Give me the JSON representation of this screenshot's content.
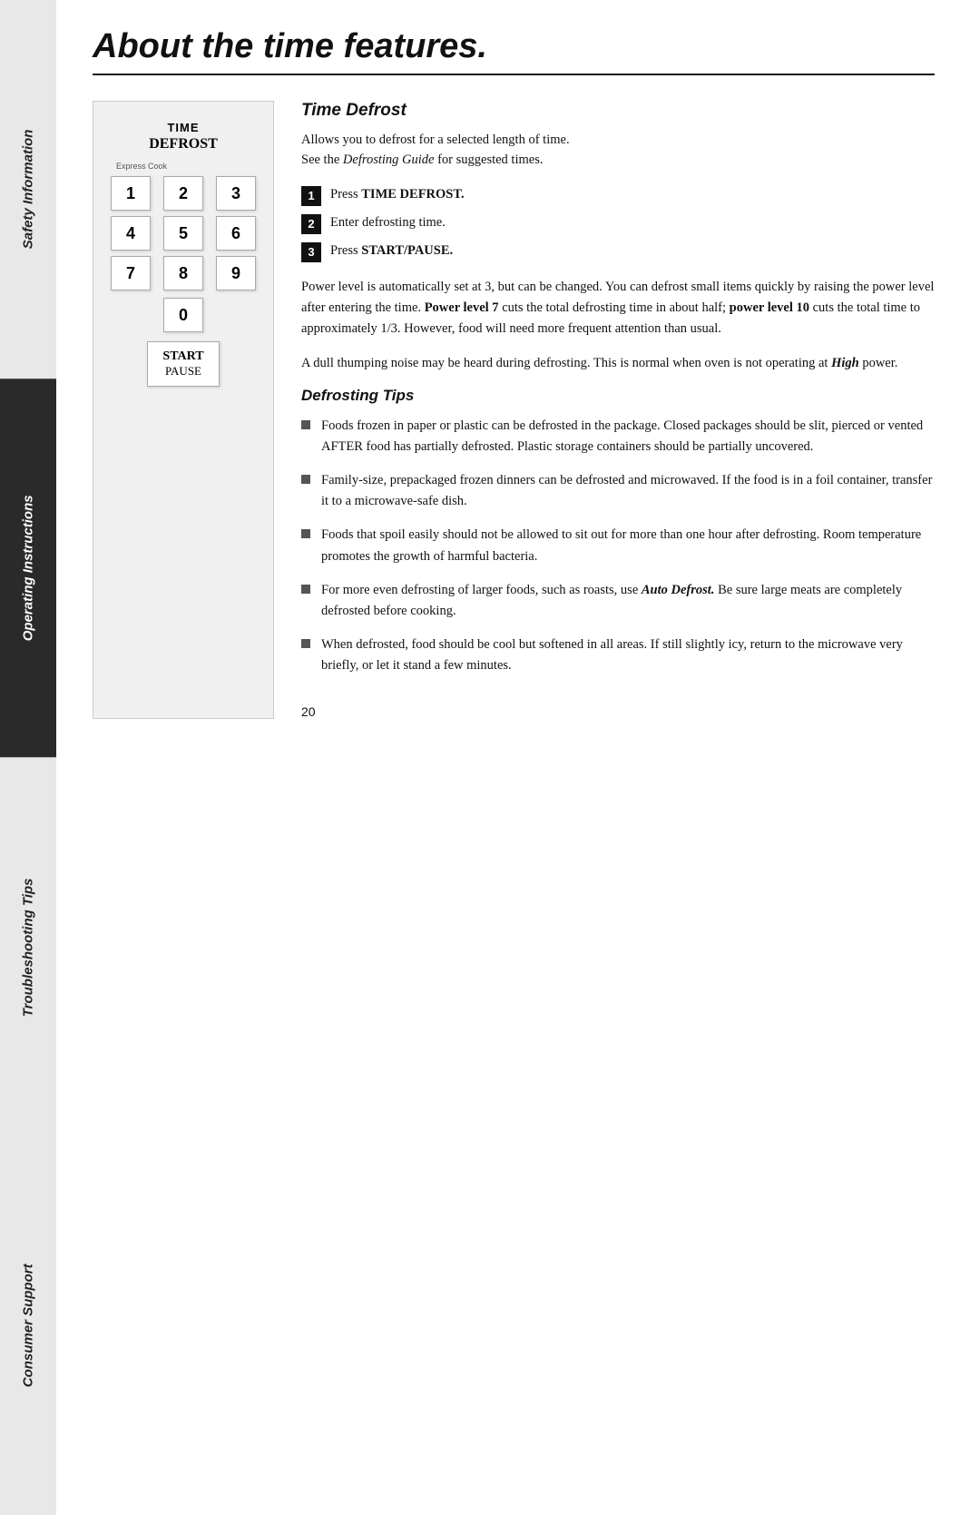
{
  "page": {
    "title": "About the time features.",
    "page_number": "20"
  },
  "sidebar": {
    "tabs": [
      {
        "id": "safety",
        "label": "Safety Information",
        "active": false,
        "italic": true
      },
      {
        "id": "operating",
        "label": "Operating Instructions",
        "active": true,
        "italic": true
      },
      {
        "id": "troubleshooting",
        "label": "Troubleshooting Tips",
        "active": false,
        "italic": true
      },
      {
        "id": "consumer",
        "label": "Consumer Support",
        "active": false,
        "italic": true
      }
    ]
  },
  "keypad": {
    "label_line1": "TIME",
    "label_line2": "DEFROST",
    "express_cook": "Express Cook",
    "keys": [
      "1",
      "2",
      "3",
      "4",
      "5",
      "6",
      "7",
      "8",
      "9",
      "0"
    ],
    "start_label": "START",
    "pause_label": "PAUSE"
  },
  "time_defrost": {
    "heading": "Time Defrost",
    "intro_line1": "Allows you to defrost for a selected length of time.",
    "intro_line2": "See the Defrosting Guide for suggested times.",
    "steps": [
      {
        "number": "1",
        "text_plain": "Press ",
        "text_bold": "TIME DEFROST."
      },
      {
        "number": "2",
        "text_plain": "Enter defrosting time.",
        "text_bold": ""
      },
      {
        "number": "3",
        "text_plain": "Press ",
        "text_bold": "START/PAUSE."
      }
    ],
    "para1": "Power level is automatically set at 3, but can be changed. You can defrost small items quickly by raising the power level after entering the time. Power level 7 cuts the total defrosting time in about half; power level 10 cuts the total time to approximately 1/3. However, food will need more frequent attention than usual.",
    "para2": "A dull thumping noise may be heard during defrosting. This is normal when oven is not operating at High power.",
    "defrosting_tips_heading": "Defrosting Tips",
    "tips": [
      "Foods frozen in paper or plastic can be defrosted in the package. Closed packages should be slit, pierced or vented AFTER food has partially defrosted. Plastic storage containers should be partially uncovered.",
      "Family-size, prepackaged frozen dinners can be defrosted and microwaved. If the food is in a foil container, transfer it to a microwave-safe dish.",
      "Foods that spoil easily should not be allowed to sit out for more than one hour after defrosting. Room temperature promotes the growth of harmful bacteria.",
      "For more even defrosting of larger foods, such as roasts, use Auto Defrost. Be sure large meats are completely defrosted before cooking.",
      "When defrosted, food should be cool but softened in all areas. If still slightly icy, return to the microwave very briefly, or let it stand a few minutes."
    ]
  }
}
